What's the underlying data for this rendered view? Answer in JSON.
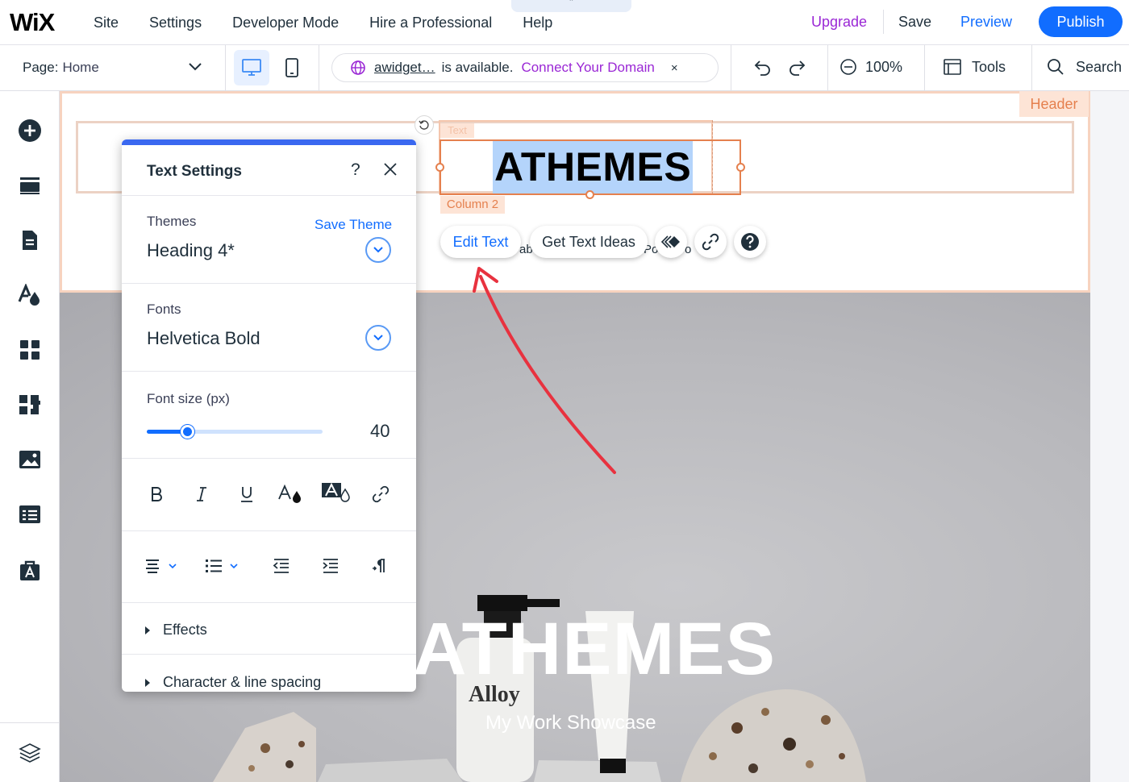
{
  "topbar": {
    "logo": "WiX",
    "menu": [
      "Site",
      "Settings",
      "Developer Mode",
      "Hire a Professional",
      "Help"
    ],
    "upgrade": "Upgrade",
    "save": "Save",
    "preview": "Preview",
    "publish": "Publish"
  },
  "toolbar": {
    "page_label": "Page:",
    "page_value": "Home",
    "domain_name": "awidget…",
    "domain_status": "is available.",
    "connect_domain": "Connect Your Domain",
    "close_glyph": "×",
    "zoom_value": "100%",
    "tools_label": "Tools",
    "search_label": "Search"
  },
  "canvas": {
    "header_tag": "Header",
    "text_tag": "Text",
    "column_tag": "Column 2",
    "heading_text": "ATHEMES",
    "ghost_left": "ab",
    "ghost_right": "Po",
    "ghost_o": "o",
    "edit_text": "Edit Text",
    "get_text_ideas": "Get Text Ideas",
    "hero_title": "ATHEMES",
    "hero_subtitle": "My Work Showcase",
    "product_brand": "Alloy",
    "product_brand_small": "Alloy"
  },
  "panel": {
    "title": "Text Settings",
    "help": "?",
    "themes_label": "Themes",
    "save_theme": "Save Theme",
    "theme_value": "Heading 4*",
    "fonts_label": "Fonts",
    "font_value": "Helvetica Bold",
    "font_size_label": "Font size (px)",
    "font_size_value": "40",
    "font_size_slider_fraction": 0.23,
    "effects_label": "Effects",
    "spacing_label": "Character & line spacing"
  },
  "colors": {
    "accent_blue": "#116dff",
    "upgrade_purple": "#9a27d5",
    "selection_orange": "#e5804e",
    "highlight": "#b4d4fb",
    "annotation_arrow": "#e8323f"
  }
}
